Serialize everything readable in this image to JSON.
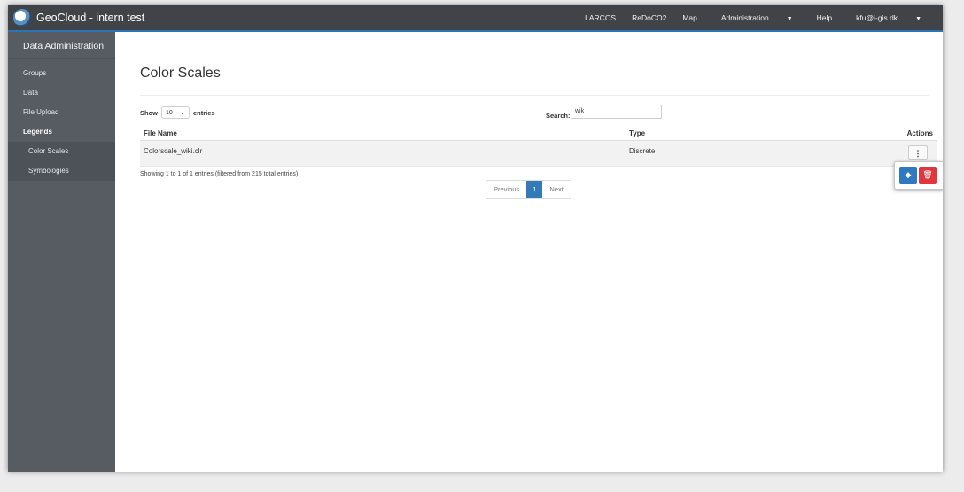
{
  "app": {
    "title": "GeoCloud - intern test"
  },
  "nav": {
    "links": [
      "LARCOS",
      "ReDoCO2",
      "Map"
    ],
    "admin": "Administration",
    "help": "Help",
    "user": "kfu@i-gis.dk"
  },
  "sidebar": {
    "title": "Data Administration",
    "items": [
      {
        "label": "Groups"
      },
      {
        "label": "Data"
      },
      {
        "label": "File Upload"
      },
      {
        "label": "Legends"
      },
      {
        "label": "Color Scales"
      },
      {
        "label": "Symbologies"
      }
    ]
  },
  "main": {
    "title": "Color Scales",
    "show_label": "Show",
    "entries_value": "10",
    "entries_label": "entries",
    "search_label": "Search:",
    "search_value": "wik",
    "columns": [
      "File Name",
      "Type",
      "Actions"
    ],
    "rows": [
      {
        "file": "Colorscale_wiki.clr",
        "type": "Discrete"
      }
    ],
    "info": "Showing 1 to 1 of 1 entries (filtered from 215 total entries)",
    "pager": {
      "previous": "Previous",
      "current": "1",
      "next": "Next"
    }
  },
  "icons": {
    "actions": "vertical-dots-icon",
    "edit": "paint-bucket-icon",
    "delete": "trash-icon"
  },
  "colors": {
    "accent": "#337ab7",
    "danger": "#e0373f",
    "navbar": "#404448",
    "sidebar": "#565c62"
  }
}
